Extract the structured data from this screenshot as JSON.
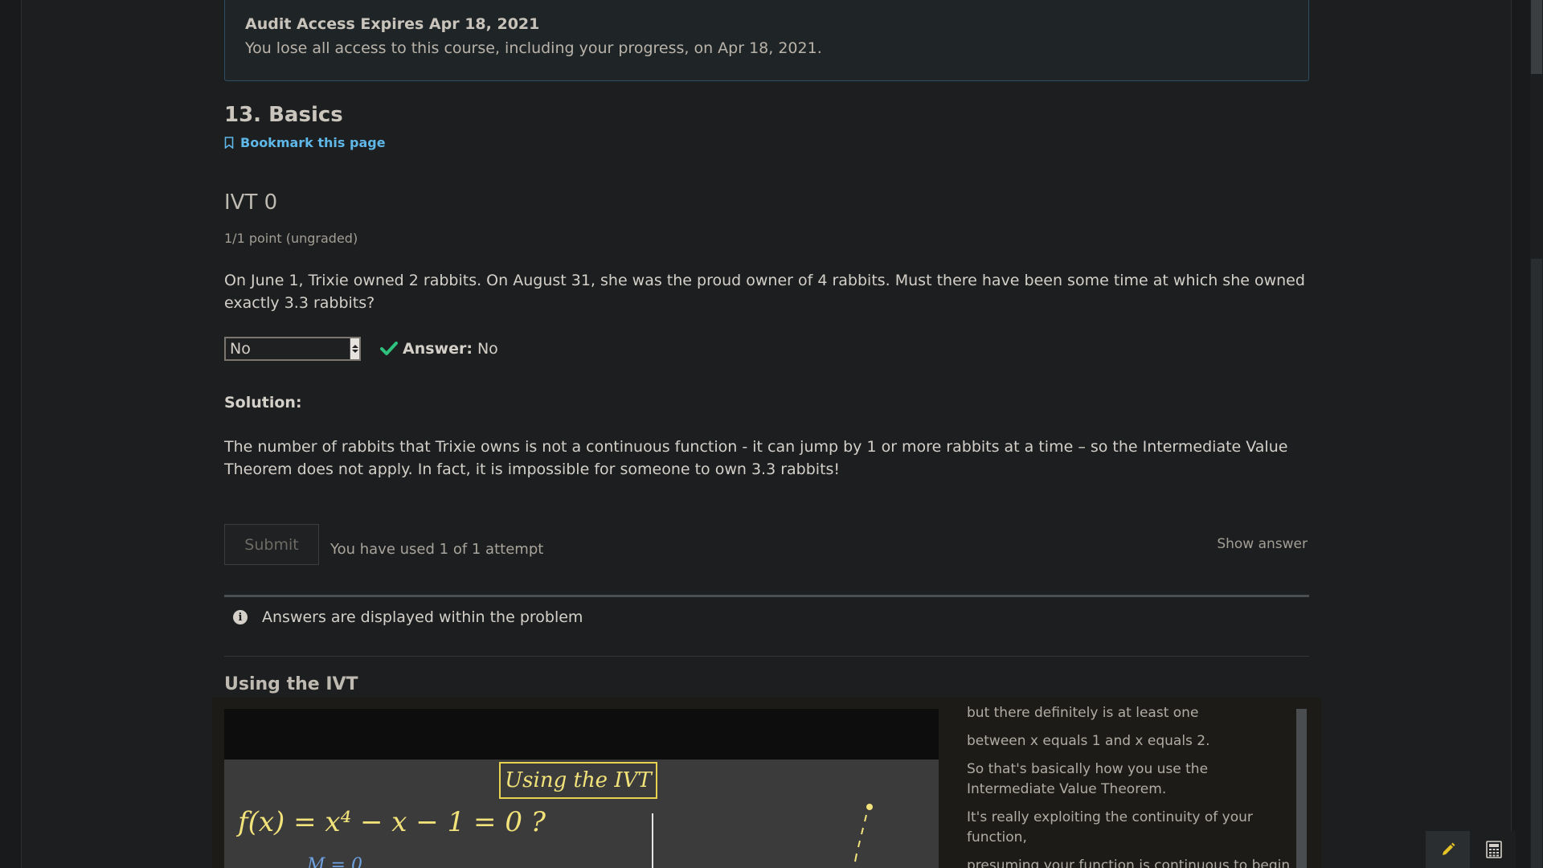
{
  "audit": {
    "title": "Audit Access Expires Apr 18, 2021",
    "description": "You lose all access to this course, including your progress, on Apr 18, 2021."
  },
  "unit": {
    "title": "13. Basics",
    "bookmark_label": "Bookmark this page"
  },
  "problem": {
    "title": "IVT 0",
    "points": "1/1 point (ungraded)",
    "question": "On June 1, Trixie owned 2 rabbits. On August 31, she was the proud owner of 4 rabbits. Must there have been some time at which she owned exactly 3.3 rabbits?",
    "selected_value": "No",
    "answer_label": "Answer:",
    "answer_value": "No",
    "solution_label": "Solution:",
    "solution_text": "The number of rabbits that Trixie owns is not a continuous function - it can jump by 1 or more rabbits at a time – so the Intermediate Value Theorem does not apply. In fact, it is impossible for someone to own 3.3 rabbits!",
    "submit_label": "Submit",
    "attempts_text": "You have used 1 of 1 attempt",
    "show_answer_label": "Show answer",
    "notice_text": "Answers are displayed within the problem"
  },
  "video": {
    "heading": "Using the IVT",
    "board_title": "Using the IVT",
    "board_equation": "f(x) =  x⁴ − x − 1 = 0 ?",
    "board_bottom": "M = 0",
    "transcript": [
      "but there definitely is at least one",
      "between x equals 1 and x equals 2.",
      "So that's basically how you use the Intermediate Value Theorem.",
      "It's really exploiting the continuity of your function,",
      "presuming your function is continuous to begin"
    ]
  },
  "colors": {
    "background": "#1c1e1f",
    "link": "#5fb7e8",
    "check": "#2ec27e",
    "board_yellow": "#f2e27a"
  },
  "icons": [
    "bookmark-icon",
    "check-icon",
    "info-icon",
    "pencil-icon",
    "calculator-icon"
  ]
}
